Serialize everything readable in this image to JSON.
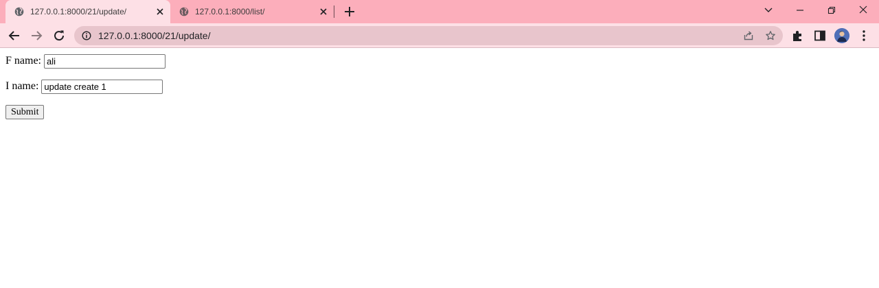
{
  "browser": {
    "tabs": [
      {
        "title": "127.0.0.1:8000/21/update/",
        "active": true,
        "favicon": "globe-icon"
      },
      {
        "title": "127.0.0.1:8000/list/",
        "active": false,
        "favicon": "globe-icon"
      }
    ],
    "url": "127.0.0.1:8000/21/update/",
    "colors": {
      "tabstrip": "#fcaebb",
      "toolbar": "#fde0e6",
      "omnibox": "#e8c5cc"
    }
  },
  "form": {
    "fname": {
      "label": "F name:",
      "value": "ali"
    },
    "lname": {
      "label": "I name:",
      "value": "update create 1"
    },
    "submit_label": "Submit"
  }
}
